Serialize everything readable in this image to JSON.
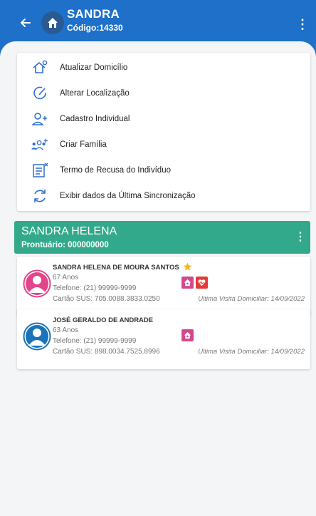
{
  "header": {
    "title": "SANDRA",
    "code": "Código:14330",
    "color": "#1e70c8"
  },
  "actions": [
    {
      "label": "Atualizar Domicílio",
      "icon": "house-settings-icon"
    },
    {
      "label": "Alterar Localização",
      "icon": "location-edit-icon"
    },
    {
      "label": "Cadastro Individual",
      "icon": "person-add-icon"
    },
    {
      "label": "Criar Família",
      "icon": "group-add-icon"
    },
    {
      "label": "Termo de Recusa do Indivíduo",
      "icon": "document-refuse-icon"
    },
    {
      "label": "Exibir dados da Última Sincronização",
      "icon": "sync-icon"
    }
  ],
  "family": {
    "name": "SANDRA HELENA",
    "prontuario": "Prontuário: 000000000",
    "color": "#32a98a"
  },
  "members": [
    {
      "name": "SANDRA HELENA DE MOURA SANTOS",
      "age": "67 Anos",
      "phone": "Telefone: (21) 99999-9999",
      "sus": "Cartão SUS: 705.0088.3833.0250",
      "last_visit": "Ultima Visita Domiciliar: 14/09/2022",
      "avatar": "female-avatar-icon",
      "avatar_color": "#e2458a",
      "responsible": true,
      "badges": [
        "home-member-icon",
        "health-condition-icon"
      ]
    },
    {
      "name": "JOSÉ GERALDO DE ANDRADE",
      "age": "63 Anos",
      "phone": "Telefone: (21) 99999-9999",
      "sus": "Cartão SUS: 898.0034.7525.8996",
      "last_visit": "Ultima Visita Domiciliar: 14/09/2022",
      "avatar": "male-avatar-icon",
      "avatar_color": "#1a73b8",
      "responsible": false,
      "badges": [
        "home-member-icon"
      ]
    }
  ],
  "colors": {
    "badge_pink": "#d3478d",
    "badge_red": "#e53935",
    "star": "#f5b21b",
    "icon_blue": "#2f6fd0"
  }
}
